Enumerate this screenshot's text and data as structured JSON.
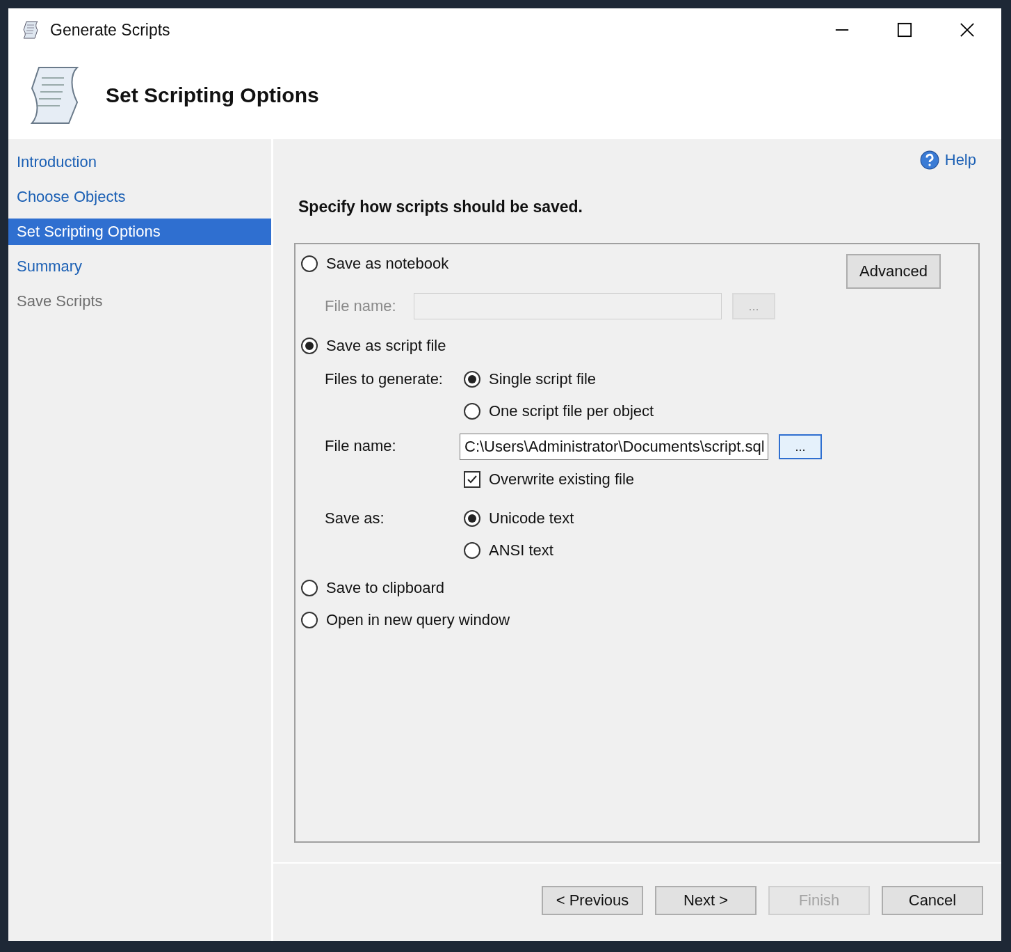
{
  "window": {
    "title": "Generate Scripts"
  },
  "header": {
    "title": "Set Scripting Options"
  },
  "sidebar": {
    "items": [
      {
        "label": "Introduction",
        "selected": false,
        "disabled": false
      },
      {
        "label": "Choose Objects",
        "selected": false,
        "disabled": false
      },
      {
        "label": "Set Scripting Options",
        "selected": true,
        "disabled": false
      },
      {
        "label": "Summary",
        "selected": false,
        "disabled": false
      },
      {
        "label": "Save Scripts",
        "selected": false,
        "disabled": true
      }
    ]
  },
  "help": {
    "label": "Help"
  },
  "instruction": "Specify how scripts should be saved.",
  "destinations": [
    {
      "kind": "notebook",
      "label": "Save as notebook",
      "selected": false
    },
    {
      "kind": "script_file",
      "label": "Save as script file",
      "selected": true
    },
    {
      "kind": "plain",
      "label": "Save to clipboard",
      "selected": false
    },
    {
      "kind": "plain",
      "label": "Open in new query window",
      "selected": false
    }
  ],
  "advanced_button": "Advanced",
  "notebook_file": {
    "label": "File name:",
    "browse": "...",
    "disabled": true
  },
  "files_to_generate": {
    "label": "Files to generate:",
    "options": [
      {
        "label": "Single script file",
        "selected": true
      },
      {
        "label": "One script file per object",
        "selected": false
      }
    ]
  },
  "script_file_name": {
    "label": "File name:",
    "value": "C:\\Users\\Administrator\\Documents\\script.sql",
    "browse": "..."
  },
  "overwrite": {
    "label": "Overwrite existing file",
    "checked": true
  },
  "save_as": {
    "label": "Save as:",
    "options": [
      {
        "label": "Unicode text",
        "selected": true
      },
      {
        "label": "ANSI text",
        "selected": false
      }
    ]
  },
  "buttons": [
    {
      "label": "< Previous",
      "disabled": false
    },
    {
      "label": "Next >",
      "disabled": false
    },
    {
      "label": "Finish",
      "disabled": true
    },
    {
      "label": "Cancel",
      "disabled": false
    }
  ]
}
